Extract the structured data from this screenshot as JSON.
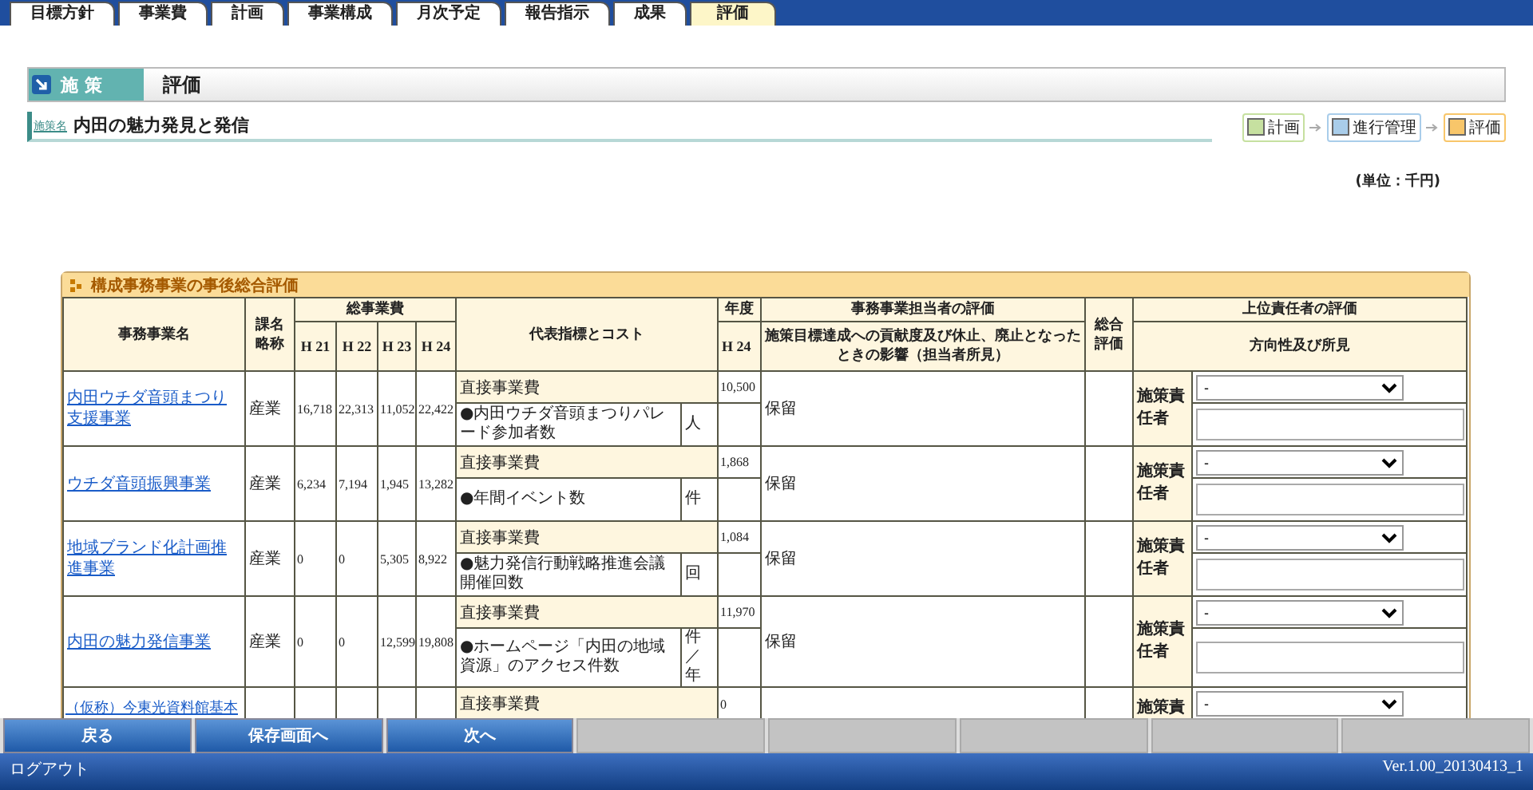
{
  "tabs": [
    {
      "label": "目標方針",
      "selected": false
    },
    {
      "label": "事業費",
      "selected": false
    },
    {
      "label": "計画",
      "selected": false
    },
    {
      "label": "事業構成",
      "selected": false
    },
    {
      "label": "月次予定",
      "selected": false
    },
    {
      "label": "報告指示",
      "selected": false
    },
    {
      "label": "成果",
      "selected": false
    },
    {
      "label": "評価",
      "selected": true
    }
  ],
  "page_header": {
    "category": "施 策",
    "title": "評価"
  },
  "policy": {
    "label": "施策名",
    "name": "内田の魅力発見と発信"
  },
  "legend": [
    {
      "label": "計画",
      "color": "#c6e0a0"
    },
    {
      "label": "進行管理",
      "color": "#a9cdea"
    },
    {
      "label": "評価",
      "color": "#f8c66a"
    }
  ],
  "unit_note": "(単位：千円)",
  "table": {
    "caption": "構成事務事業の事後総合評価",
    "headers": {
      "name": "事務事業名",
      "dept": "課名略称",
      "total_cost": "総事業費",
      "years": [
        "H 21",
        "H 22",
        "H 23",
        "H 24"
      ],
      "indicator": "代表指標とコスト",
      "fiscal_year": "年度",
      "fiscal_year_sub": "H 24",
      "staff_eval": "事務事業担当者の評価",
      "staff_eval_sub": "施策目標達成への貢献度及び休止、廃止となったときの影響（担当者所見）",
      "overall": "総合評価",
      "superior_eval": "上位責任者の評価",
      "superior_eval_sub": "方向性及び所見"
    },
    "rows": [
      {
        "kind": "full",
        "name": "内田ウチダ音頭まつり支援事業",
        "dept": "産業",
        "costs": [
          "16,718",
          "22,313",
          "11,052",
          "22,422"
        ],
        "cost_label": "直接事業費",
        "cost_value": "10,500",
        "indicator": "●内田ウチダ音頭まつりパレード参加者数",
        "unit": "人",
        "evaluation": "保留",
        "officer": "施策責任者",
        "direction": "-"
      },
      {
        "kind": "full",
        "name": "ウチダ音頭振興事業",
        "dept": "産業",
        "costs": [
          "6,234",
          "7,194",
          "1,945",
          "13,282"
        ],
        "cost_label": "直接事業費",
        "cost_value": "1,868",
        "indicator": "●年間イベント数",
        "unit": "件",
        "evaluation": "保留",
        "officer": "施策責任者",
        "direction": "-"
      },
      {
        "kind": "full",
        "name": "地域ブランド化計画推進事業",
        "dept": "産業",
        "costs": [
          "0",
          "0",
          "5,305",
          "8,922"
        ],
        "cost_label": "直接事業費",
        "cost_value": "1,084",
        "indicator": "●魅力発信行動戦略推進会議開催回数",
        "unit": "回",
        "evaluation": "保留",
        "officer": "施策責任者",
        "direction": "-"
      },
      {
        "kind": "full",
        "name": "内田の魅力発信事業",
        "dept": "産業",
        "costs": [
          "0",
          "0",
          "12,599",
          "19,808"
        ],
        "cost_label": "直接事業費",
        "cost_value": "11,970",
        "indicator": "●ホームページ「内田の地域資源」のアクセス件数",
        "unit": "件／年",
        "evaluation": "保留",
        "officer": "施策責任者",
        "direction": "-"
      },
      {
        "kind": "partial",
        "name": "（仮称）今東光資料館基本",
        "cost_label": "直接事業費",
        "cost_value": "0",
        "officer": "施策責",
        "direction": "-"
      }
    ]
  },
  "buttons": [
    {
      "label": "戻る",
      "disabled": false
    },
    {
      "label": "保存画面へ",
      "disabled": false
    },
    {
      "label": "次へ",
      "disabled": false
    },
    {
      "disabled": true
    },
    {
      "disabled": true
    },
    {
      "disabled": true
    },
    {
      "disabled": true
    },
    {
      "disabled": true
    }
  ],
  "footer": {
    "logout": "ログアウト",
    "version": "Ver.1.00_20130413_1"
  }
}
